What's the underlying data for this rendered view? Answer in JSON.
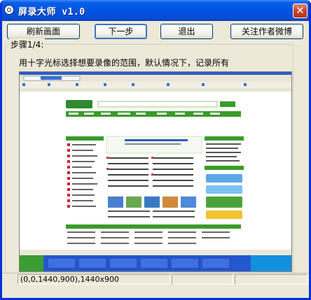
{
  "window": {
    "title": "屏录大师 v1.0",
    "close_glyph": "✕"
  },
  "toolbar": {
    "refresh_label": "刷新画面",
    "next_label": "下一步",
    "exit_label": "退出",
    "follow_label": "关注作者微博"
  },
  "step": {
    "title": "步骤1/4:",
    "instruction": "用十字光标选择想要录像的范围，默认情况下，记录所有"
  },
  "preview": {
    "description": "desktop-screenshot-preview"
  },
  "status": {
    "region": "(0,0,1440,900),1440x900",
    "cell2": "",
    "cell3": ""
  },
  "colors": {
    "titlebar": "#0054e3",
    "window_bg": "#ece9d8",
    "web_green": "#3a9b2a",
    "taskbar": "#2458d0"
  }
}
